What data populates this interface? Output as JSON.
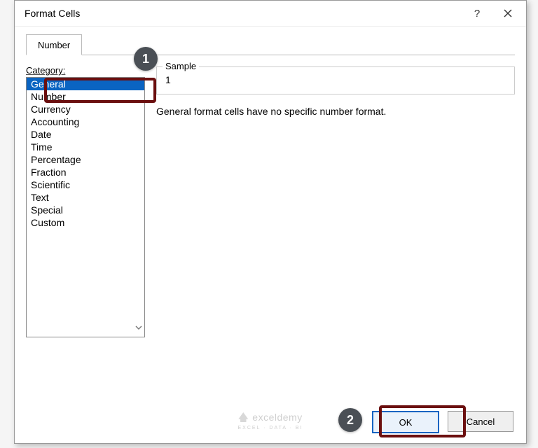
{
  "dialog": {
    "title": "Format Cells"
  },
  "tabs": {
    "number": "Number"
  },
  "category": {
    "label": "Category:",
    "items": [
      "General",
      "Number",
      "Currency",
      "Accounting",
      "Date",
      "Time",
      "Percentage",
      "Fraction",
      "Scientific",
      "Text",
      "Special",
      "Custom"
    ],
    "selected_index": 0
  },
  "sample": {
    "label": "Sample",
    "value": "1"
  },
  "description": "General format cells have no specific number format.",
  "buttons": {
    "ok": "OK",
    "cancel": "Cancel"
  },
  "annotations": {
    "step1": "1",
    "step2": "2"
  },
  "watermark": {
    "brand": "exceldemy",
    "tagline": "EXCEL · DATA · BI"
  }
}
